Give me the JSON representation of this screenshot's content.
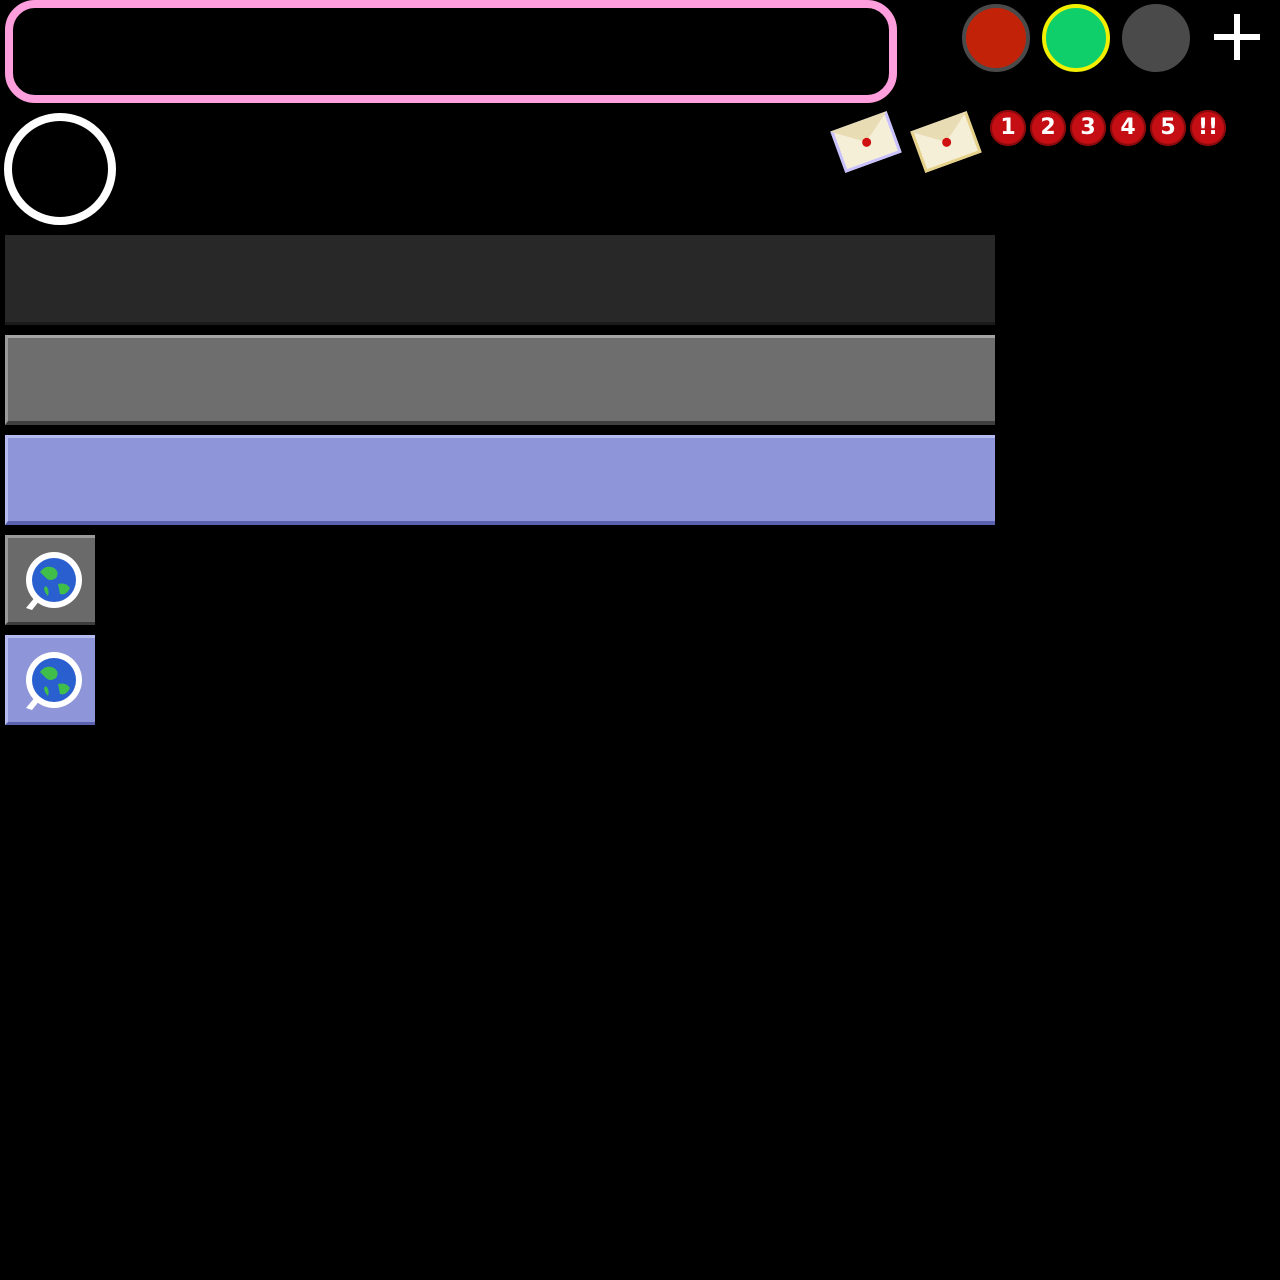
{
  "toolbar": {
    "text_field_value": "",
    "status_dots": [
      {
        "name": "red-status-dot",
        "color": "#c22208"
      },
      {
        "name": "green-status-dot",
        "color": "#0fcf6b",
        "ring": "#f2f000"
      },
      {
        "name": "gray-status-dot",
        "color": "#4a4a4a"
      }
    ],
    "add_icon": "plus-icon"
  },
  "avatar": {
    "icon": "empty-avatar-ring"
  },
  "mail": {
    "icons": [
      "envelope-icon",
      "envelope-icon"
    ]
  },
  "badges": [
    "1",
    "2",
    "3",
    "4",
    "5",
    "!!"
  ],
  "bars": [
    {
      "name": "dark-bar",
      "color": "#282828"
    },
    {
      "name": "gray-bar",
      "color": "#6e6e6e"
    },
    {
      "name": "blue-bar",
      "color": "#8e95d8"
    }
  ],
  "globe_buttons": [
    {
      "icon": "globe-search-icon",
      "style": "gray"
    },
    {
      "icon": "globe-search-icon",
      "style": "blue"
    }
  ]
}
